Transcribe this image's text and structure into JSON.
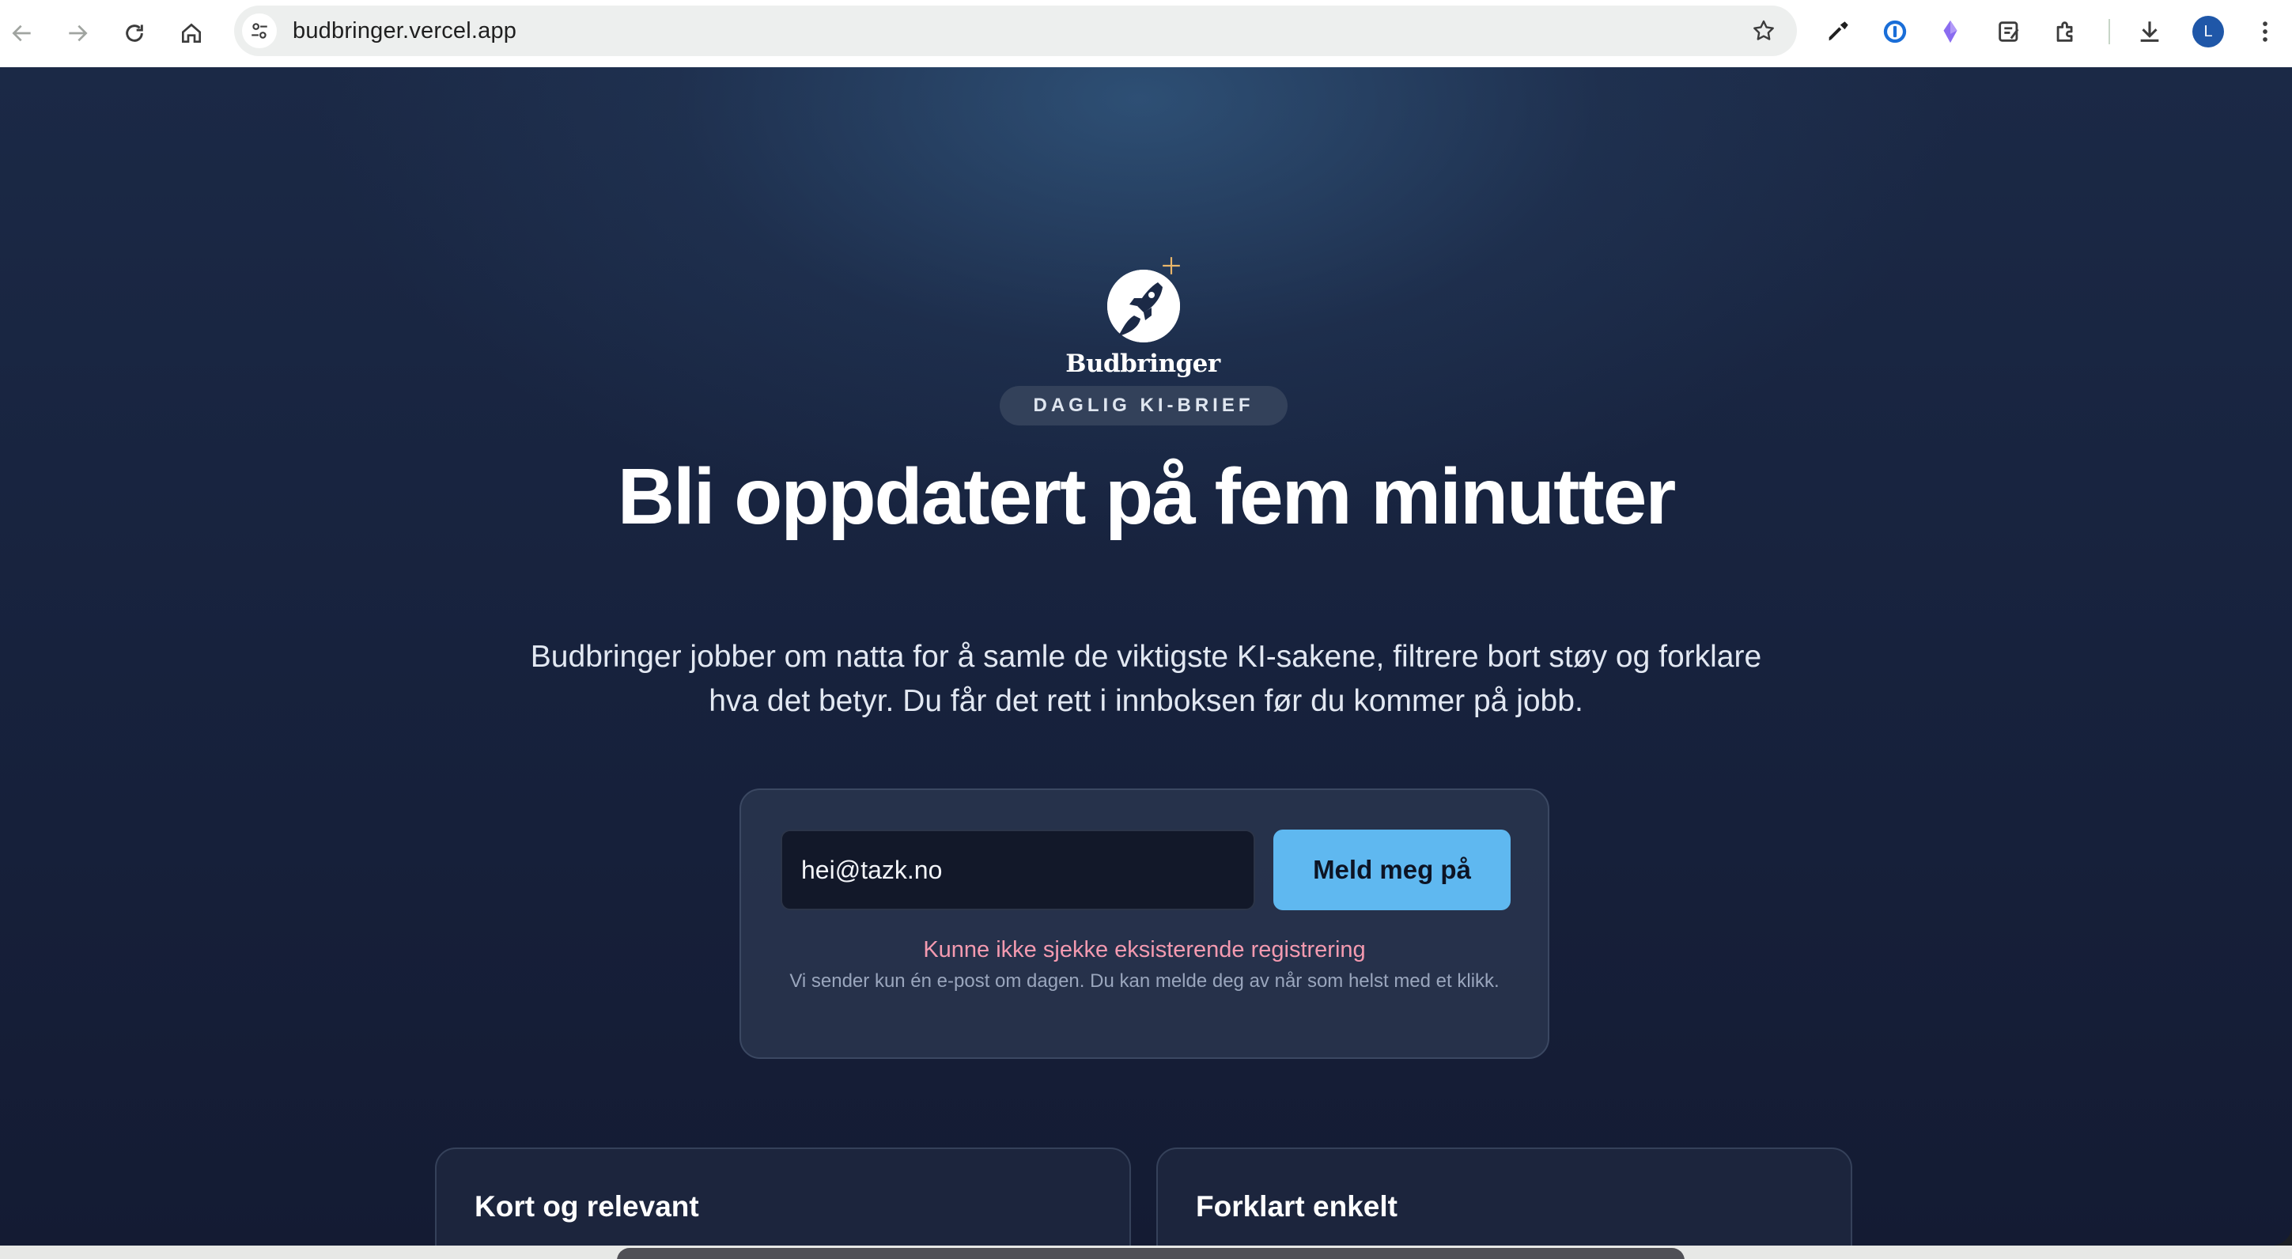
{
  "browser": {
    "url": "budbringer.vercel.app",
    "profile_initial": "L",
    "colors": {
      "omnibox_bg": "#edefee",
      "avatar_bg": "#1f57a8"
    },
    "nav_icons": [
      "back-icon",
      "forward-icon",
      "reload-icon",
      "home-icon"
    ],
    "extension_icons": [
      "eyedropper-icon",
      "password-manager-icon",
      "gem-icon",
      "notes-icon",
      "puzzle-extensions-icon",
      "download-icon",
      "more-menu-icon"
    ]
  },
  "page": {
    "logo": {
      "wordmark": "Budbringer"
    },
    "pill_label": "DAGLIG KI-BRIEF",
    "headline": "Bli oppdatert på fem minutter",
    "subheadline": "Budbringer jobber om natta for å samle de viktigste KI-sakene, filtrere bort støy og forklare hva det betyr. Du får det rett i innboksen før du kommer på jobb.",
    "form": {
      "email_value": "hei@tazk.no",
      "submit_label": "Meld meg på",
      "error_message": "Kunne ikke sjekke eksisterende registrering",
      "note": "Vi sender kun én e-post om dagen. Du kan melde deg av når som helst med et klikk."
    },
    "features": [
      {
        "title": "Kort og relevant"
      },
      {
        "title": "Forklart enkelt"
      }
    ],
    "colors": {
      "background": "#17223d",
      "accent_button": "#5fb8f0",
      "error_text": "#f49ab0"
    }
  }
}
